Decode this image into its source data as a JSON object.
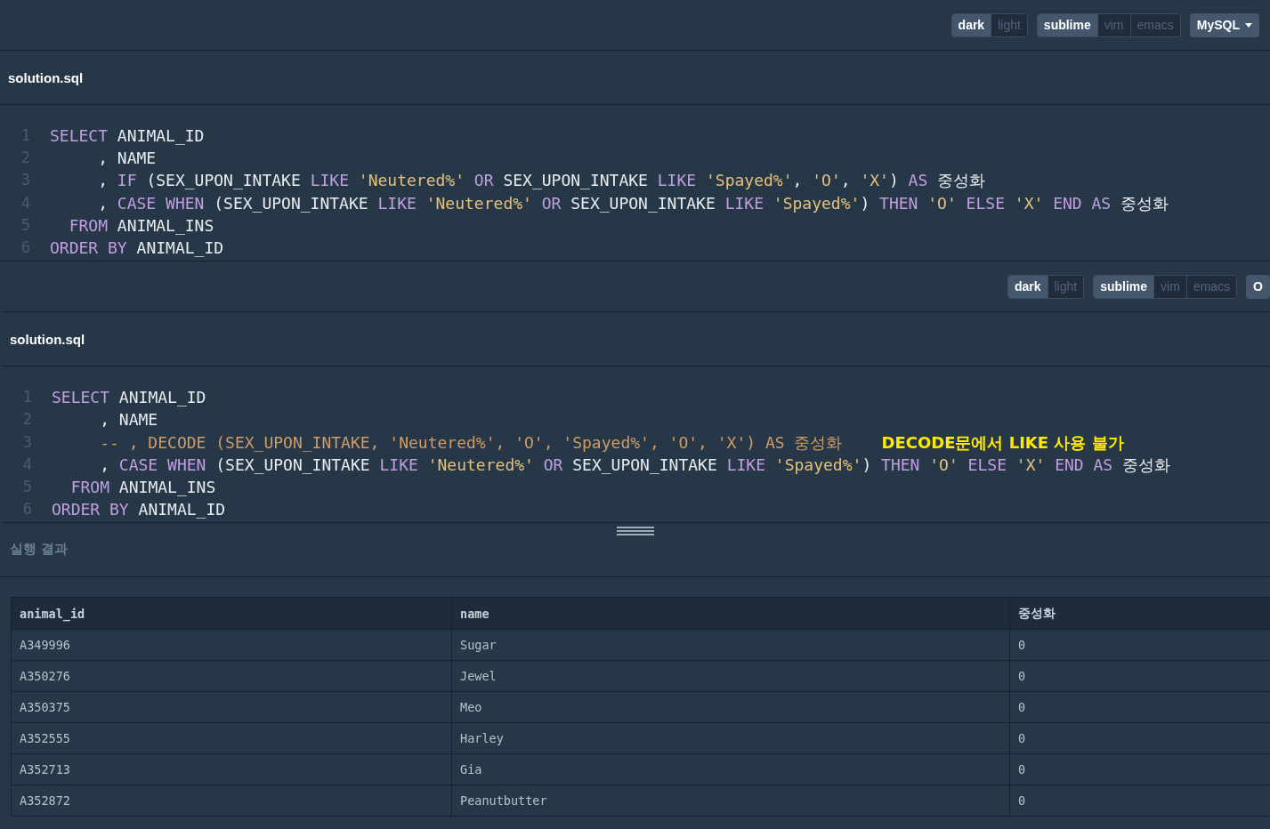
{
  "editors": [
    {
      "toolbar": {
        "themes": [
          {
            "label": "dark",
            "selected": true
          },
          {
            "label": "light",
            "selected": false
          }
        ],
        "keymaps": [
          {
            "label": "sublime",
            "selected": true
          },
          {
            "label": "vim",
            "selected": false
          },
          {
            "label": "emacs",
            "selected": false
          }
        ],
        "language": "MySQL",
        "language_menu": true
      },
      "filename": "solution.sql",
      "lines": [
        {
          "number": "1",
          "tokens": [
            {
              "kind": "kw",
              "text": "SELECT"
            },
            {
              "kind": "id",
              "text": " ANIMAL_ID"
            }
          ]
        },
        {
          "number": "2",
          "tokens": [
            {
              "kind": "id",
              "text": "     , NAME"
            }
          ]
        },
        {
          "number": "3",
          "tokens": [
            {
              "kind": "id",
              "text": "     , "
            },
            {
              "kind": "kw",
              "text": "IF"
            },
            {
              "kind": "id",
              "text": " (SEX_UPON_INTAKE "
            },
            {
              "kind": "kw",
              "text": "LIKE"
            },
            {
              "kind": "str",
              "text": " 'Neutered%'"
            },
            {
              "kind": "kw",
              "text": " OR"
            },
            {
              "kind": "id",
              "text": " SEX_UPON_INTAKE "
            },
            {
              "kind": "kw",
              "text": "LIKE"
            },
            {
              "kind": "str",
              "text": " 'Spayed%'"
            },
            {
              "kind": "id",
              "text": ", "
            },
            {
              "kind": "str",
              "text": "'O'"
            },
            {
              "kind": "id",
              "text": ", "
            },
            {
              "kind": "str",
              "text": "'X'"
            },
            {
              "kind": "id",
              "text": ") "
            },
            {
              "kind": "kw",
              "text": "AS"
            },
            {
              "kind": "id",
              "text": " 중성화"
            }
          ]
        },
        {
          "number": "4",
          "tokens": [
            {
              "kind": "id",
              "text": "     , "
            },
            {
              "kind": "kw",
              "text": "CASE WHEN"
            },
            {
              "kind": "id",
              "text": " (SEX_UPON_INTAKE "
            },
            {
              "kind": "kw",
              "text": "LIKE"
            },
            {
              "kind": "str",
              "text": " 'Neutered%'"
            },
            {
              "kind": "kw",
              "text": " OR"
            },
            {
              "kind": "id",
              "text": " SEX_UPON_INTAKE "
            },
            {
              "kind": "kw",
              "text": "LIKE"
            },
            {
              "kind": "str",
              "text": " 'Spayed%'"
            },
            {
              "kind": "id",
              "text": ") "
            },
            {
              "kind": "kw",
              "text": "THEN"
            },
            {
              "kind": "str",
              "text": " 'O'"
            },
            {
              "kind": "kw",
              "text": " ELSE"
            },
            {
              "kind": "str",
              "text": " 'X'"
            },
            {
              "kind": "kw",
              "text": " END AS"
            },
            {
              "kind": "id",
              "text": " 중성화"
            }
          ]
        },
        {
          "number": "5",
          "tokens": [
            {
              "kind": "kw",
              "text": "  FROM"
            },
            {
              "kind": "id",
              "text": " ANIMAL_INS"
            }
          ]
        },
        {
          "number": "6",
          "tokens": [
            {
              "kind": "kw",
              "text": "ORDER BY"
            },
            {
              "kind": "id",
              "text": " ANIMAL_ID"
            }
          ]
        }
      ]
    },
    {
      "toolbar": {
        "themes": [
          {
            "label": "dark",
            "selected": true
          },
          {
            "label": "light",
            "selected": false
          }
        ],
        "keymaps": [
          {
            "label": "sublime",
            "selected": true
          },
          {
            "label": "vim",
            "selected": false
          },
          {
            "label": "emacs",
            "selected": false
          }
        ],
        "language": "O",
        "language_menu": false
      },
      "filename": "solution.sql",
      "lines": [
        {
          "number": "1",
          "tokens": [
            {
              "kind": "kw",
              "text": "SELECT"
            },
            {
              "kind": "id",
              "text": " ANIMAL_ID"
            }
          ]
        },
        {
          "number": "2",
          "tokens": [
            {
              "kind": "id",
              "text": "     , NAME"
            }
          ]
        },
        {
          "number": "3",
          "tokens": [
            {
              "kind": "comment",
              "text": "     -- , DECODE (SEX_UPON_INTAKE, 'Neutered%', 'O', 'Spayed%', 'O', 'X') AS 중성화"
            },
            {
              "kind": "note",
              "text": "DECODE문에서 LIKE 사용 불가"
            }
          ]
        },
        {
          "number": "4",
          "tokens": [
            {
              "kind": "id",
              "text": "     , "
            },
            {
              "kind": "kw",
              "text": "CASE WHEN"
            },
            {
              "kind": "id",
              "text": " (SEX_UPON_INTAKE "
            },
            {
              "kind": "kw",
              "text": "LIKE"
            },
            {
              "kind": "str",
              "text": " 'Neutered%'"
            },
            {
              "kind": "kw",
              "text": " OR"
            },
            {
              "kind": "id",
              "text": " SEX_UPON_INTAKE "
            },
            {
              "kind": "kw",
              "text": "LIKE"
            },
            {
              "kind": "str",
              "text": " 'Spayed%'"
            },
            {
              "kind": "id",
              "text": ") "
            },
            {
              "kind": "kw",
              "text": "THEN"
            },
            {
              "kind": "str",
              "text": " 'O'"
            },
            {
              "kind": "kw",
              "text": " ELSE"
            },
            {
              "kind": "str",
              "text": " 'X'"
            },
            {
              "kind": "kw",
              "text": " END AS"
            },
            {
              "kind": "id",
              "text": " 중성화"
            }
          ]
        },
        {
          "number": "5",
          "tokens": [
            {
              "kind": "kw",
              "text": "  FROM"
            },
            {
              "kind": "id",
              "text": " ANIMAL_INS"
            }
          ]
        },
        {
          "number": "6",
          "tokens": [
            {
              "kind": "kw",
              "text": "ORDER BY"
            },
            {
              "kind": "id",
              "text": " ANIMAL_ID"
            }
          ]
        }
      ]
    }
  ],
  "result": {
    "title": "실행 결과",
    "columns": [
      "animal_id",
      "name",
      "중성화"
    ],
    "rows": [
      [
        "A349996",
        "Sugar",
        "0"
      ],
      [
        "A350276",
        "Jewel",
        "0"
      ],
      [
        "A350375",
        "Meo",
        "0"
      ],
      [
        "A352555",
        "Harley",
        "0"
      ],
      [
        "A352713",
        "Gia",
        "0"
      ],
      [
        "A352872",
        "Peanutbutter",
        "0"
      ]
    ]
  }
}
